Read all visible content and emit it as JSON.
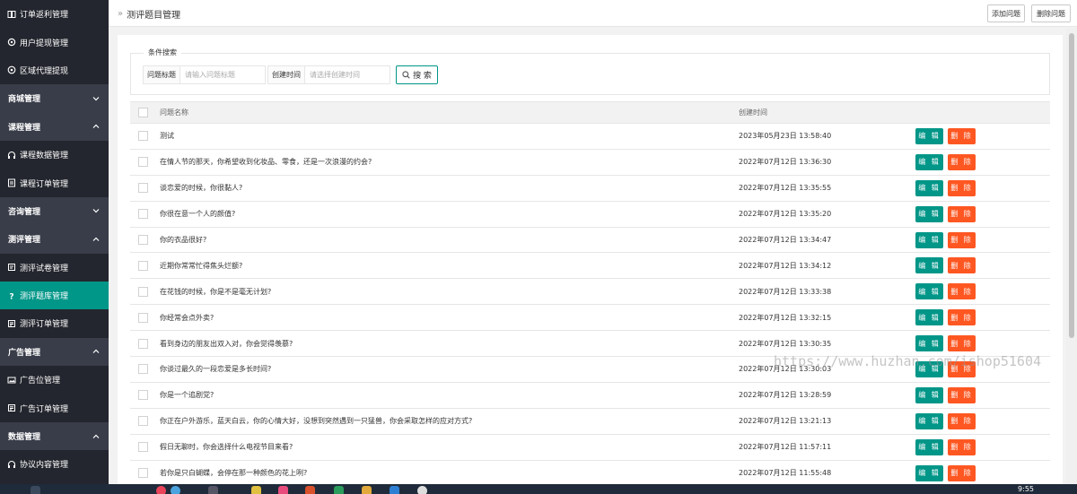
{
  "sidebar": {
    "items": [
      {
        "label": "订单返利管理",
        "kind": "top",
        "icon": "list-icon"
      },
      {
        "label": "用户提现管理",
        "kind": "top",
        "icon": "gear-icon"
      },
      {
        "label": "区域代理提现",
        "kind": "top",
        "icon": "location-icon"
      },
      {
        "label": "商城管理",
        "kind": "group",
        "chevron": "down"
      },
      {
        "label": "课程管理",
        "kind": "group",
        "chevron": "up"
      },
      {
        "label": "课程数据管理",
        "kind": "sub",
        "icon": "headphones-icon"
      },
      {
        "label": "课程订单管理",
        "kind": "sub",
        "icon": "document-icon"
      },
      {
        "label": "咨询管理",
        "kind": "group",
        "chevron": "down"
      },
      {
        "label": "测评管理",
        "kind": "group",
        "chevron": "up"
      },
      {
        "label": "测评试卷管理",
        "kind": "sub",
        "icon": "paper-icon"
      },
      {
        "label": "测评题库管理",
        "kind": "sub",
        "icon": "question-icon",
        "active": true
      },
      {
        "label": "测评订单管理",
        "kind": "sub",
        "icon": "form-icon"
      },
      {
        "label": "广告管理",
        "kind": "group",
        "chevron": "up"
      },
      {
        "label": "广告位管理",
        "kind": "sub",
        "icon": "image-icon"
      },
      {
        "label": "广告订单管理",
        "kind": "sub",
        "icon": "form-icon"
      },
      {
        "label": "数据管理",
        "kind": "group",
        "chevron": "up"
      },
      {
        "label": "协议内容管理",
        "kind": "sub",
        "icon": "headphones-icon"
      }
    ]
  },
  "header": {
    "breadcrumb_sep": "»",
    "title": "测评题目管理",
    "add_label": "添加问题",
    "delete_label": "删除问题"
  },
  "search": {
    "legend": "条件搜索",
    "title_label": "问题标题",
    "title_placeholder": "请输入问题标题",
    "time_label": "创建时间",
    "time_placeholder": "请选择创建时间",
    "button_label": "搜 索"
  },
  "table": {
    "columns": [
      "问题名称",
      "创建时间"
    ],
    "edit_label": "编 辑",
    "delete_label": "删 除",
    "rows": [
      {
        "name": "测试",
        "time": "2023年05月23日 13:58:40"
      },
      {
        "name": "在情人节的那天，你希望收到化妆品、零食，还是一次浪漫的约会?",
        "time": "2022年07月12日 13:36:30"
      },
      {
        "name": "谈恋爱的时候，你很黏人?",
        "time": "2022年07月12日 13:35:55"
      },
      {
        "name": "你很在意一个人的颜值?",
        "time": "2022年07月12日 13:35:20"
      },
      {
        "name": "你的衣品很好?",
        "time": "2022年07月12日 13:34:47"
      },
      {
        "name": "近期你常常忙得焦头烂额?",
        "time": "2022年07月12日 13:34:12"
      },
      {
        "name": "在花钱的时候，你是不是毫无计划?",
        "time": "2022年07月12日 13:33:38"
      },
      {
        "name": "你经常会点外卖?",
        "time": "2022年07月12日 13:32:15"
      },
      {
        "name": "看到身边的朋友出双入对，你会觉得羡慕?",
        "time": "2022年07月12日 13:30:35"
      },
      {
        "name": "你谈过最久的一段恋爱是多长时间?",
        "time": "2022年07月12日 13:30:03"
      },
      {
        "name": "你是一个追剧党?",
        "time": "2022年07月12日 13:28:59"
      },
      {
        "name": "你正在户外游乐，蓝天白云，你的心情大好，没想到突然遇到一只猛兽，你会采取怎样的应对方式?",
        "time": "2022年07月12日 13:21:13"
      },
      {
        "name": "假日无聊时，你会选择什么电视节目来看?",
        "time": "2022年07月12日 11:57:11"
      },
      {
        "name": "若你是只白蝴蝶，会停在那一种颜色的花上咧?",
        "time": "2022年07月12日 11:55:48"
      }
    ]
  },
  "watermark": "https://www.huzhan.com/ishop51604",
  "taskbar": {
    "clock": "9:55"
  },
  "colors": {
    "accent": "#009688",
    "danger": "#ff5722",
    "sidebar": "#23262e",
    "sidebar_group": "#393d49"
  }
}
